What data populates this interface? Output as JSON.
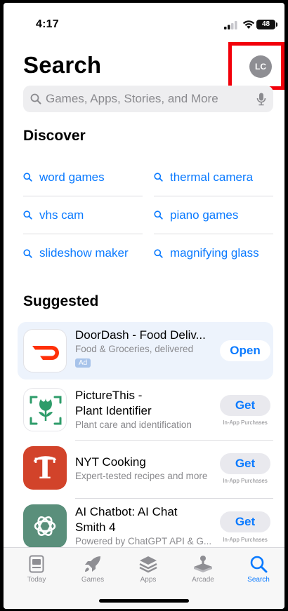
{
  "status": {
    "time": "4:17",
    "battery": "48"
  },
  "header": {
    "title": "Search",
    "avatar_initials": "LC"
  },
  "search": {
    "placeholder": "Games, Apps, Stories, and More"
  },
  "discover": {
    "heading": "Discover",
    "items": [
      "word games",
      "thermal camera",
      "vhs cam",
      "piano games",
      "slideshow maker",
      "magnifying glass"
    ]
  },
  "suggested": {
    "heading": "Suggested",
    "apps": [
      {
        "name": "DoorDash - Food Deliv...",
        "subtitle": "Food & Groceries, delivered",
        "badge": "Ad",
        "button": "Open",
        "iap": ""
      },
      {
        "name": "PictureThis -\nPlant Identifier",
        "subtitle": "Plant care and identification",
        "badge": "",
        "button": "Get",
        "iap": "In-App Purchases"
      },
      {
        "name": "NYT Cooking",
        "subtitle": "Expert-tested recipes and more",
        "badge": "",
        "button": "Get",
        "iap": "In-App Purchases"
      },
      {
        "name": "AI Chatbot: AI Chat\nSmith 4",
        "subtitle": "Powered by ChatGPT API & G...",
        "badge": "",
        "button": "Get",
        "iap": "In-App Purchases"
      }
    ]
  },
  "tabs": [
    {
      "label": "Today",
      "icon": "today-icon",
      "active": false
    },
    {
      "label": "Games",
      "icon": "rocket-icon",
      "active": false
    },
    {
      "label": "Apps",
      "icon": "layers-icon",
      "active": false
    },
    {
      "label": "Arcade",
      "icon": "joystick-icon",
      "active": false
    },
    {
      "label": "Search",
      "icon": "search-icon",
      "active": true
    }
  ],
  "colors": {
    "accent": "#0a7aff",
    "highlight_box": "#f2000a",
    "doordash": "#ff3008",
    "picturethis": "#2e9c6a",
    "nyt": "#d2432a",
    "chatbot": "#5a8f7b"
  }
}
